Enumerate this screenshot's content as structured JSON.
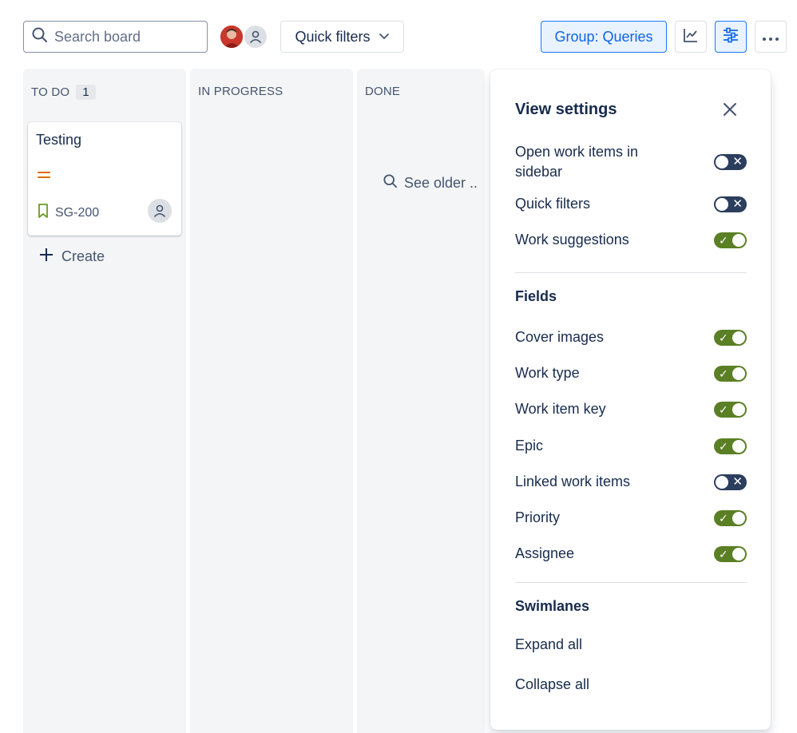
{
  "toolbar": {
    "search_placeholder": "Search board",
    "quick_filters_label": "Quick filters",
    "group_label": "Group: Queries",
    "insights_icon": "chart-line-icon",
    "settings_icon": "sliders-icon",
    "more_icon": "more-icon"
  },
  "columns": [
    {
      "title": "TO DO",
      "count": "1"
    },
    {
      "title": "IN PROGRESS"
    },
    {
      "title": "DONE",
      "see_older": "See older .."
    }
  ],
  "card": {
    "title": "Testing",
    "key": "SG-200",
    "priority": "medium"
  },
  "create_label": "Create",
  "panel": {
    "title": "View settings",
    "settings": [
      {
        "label": "Open work items in sidebar",
        "on": false
      },
      {
        "label": "Quick filters",
        "on": false
      },
      {
        "label": "Work suggestions",
        "on": true
      }
    ],
    "fields_heading": "Fields",
    "fields": [
      {
        "label": "Cover images",
        "on": true
      },
      {
        "label": "Work type",
        "on": true
      },
      {
        "label": "Work item key",
        "on": true
      },
      {
        "label": "Epic",
        "on": true
      },
      {
        "label": "Linked work items",
        "on": false
      },
      {
        "label": "Priority",
        "on": true
      },
      {
        "label": "Assignee",
        "on": true
      }
    ],
    "swimlanes_heading": "Swimlanes",
    "expand_all": "Expand all",
    "collapse_all": "Collapse all"
  },
  "colors": {
    "toggle_on": "#5b7f24",
    "toggle_off": "#2c3e5d",
    "accent_blue": "#0c66e4",
    "priority_medium": "#e06c00",
    "story_green": "#6a9a23"
  }
}
